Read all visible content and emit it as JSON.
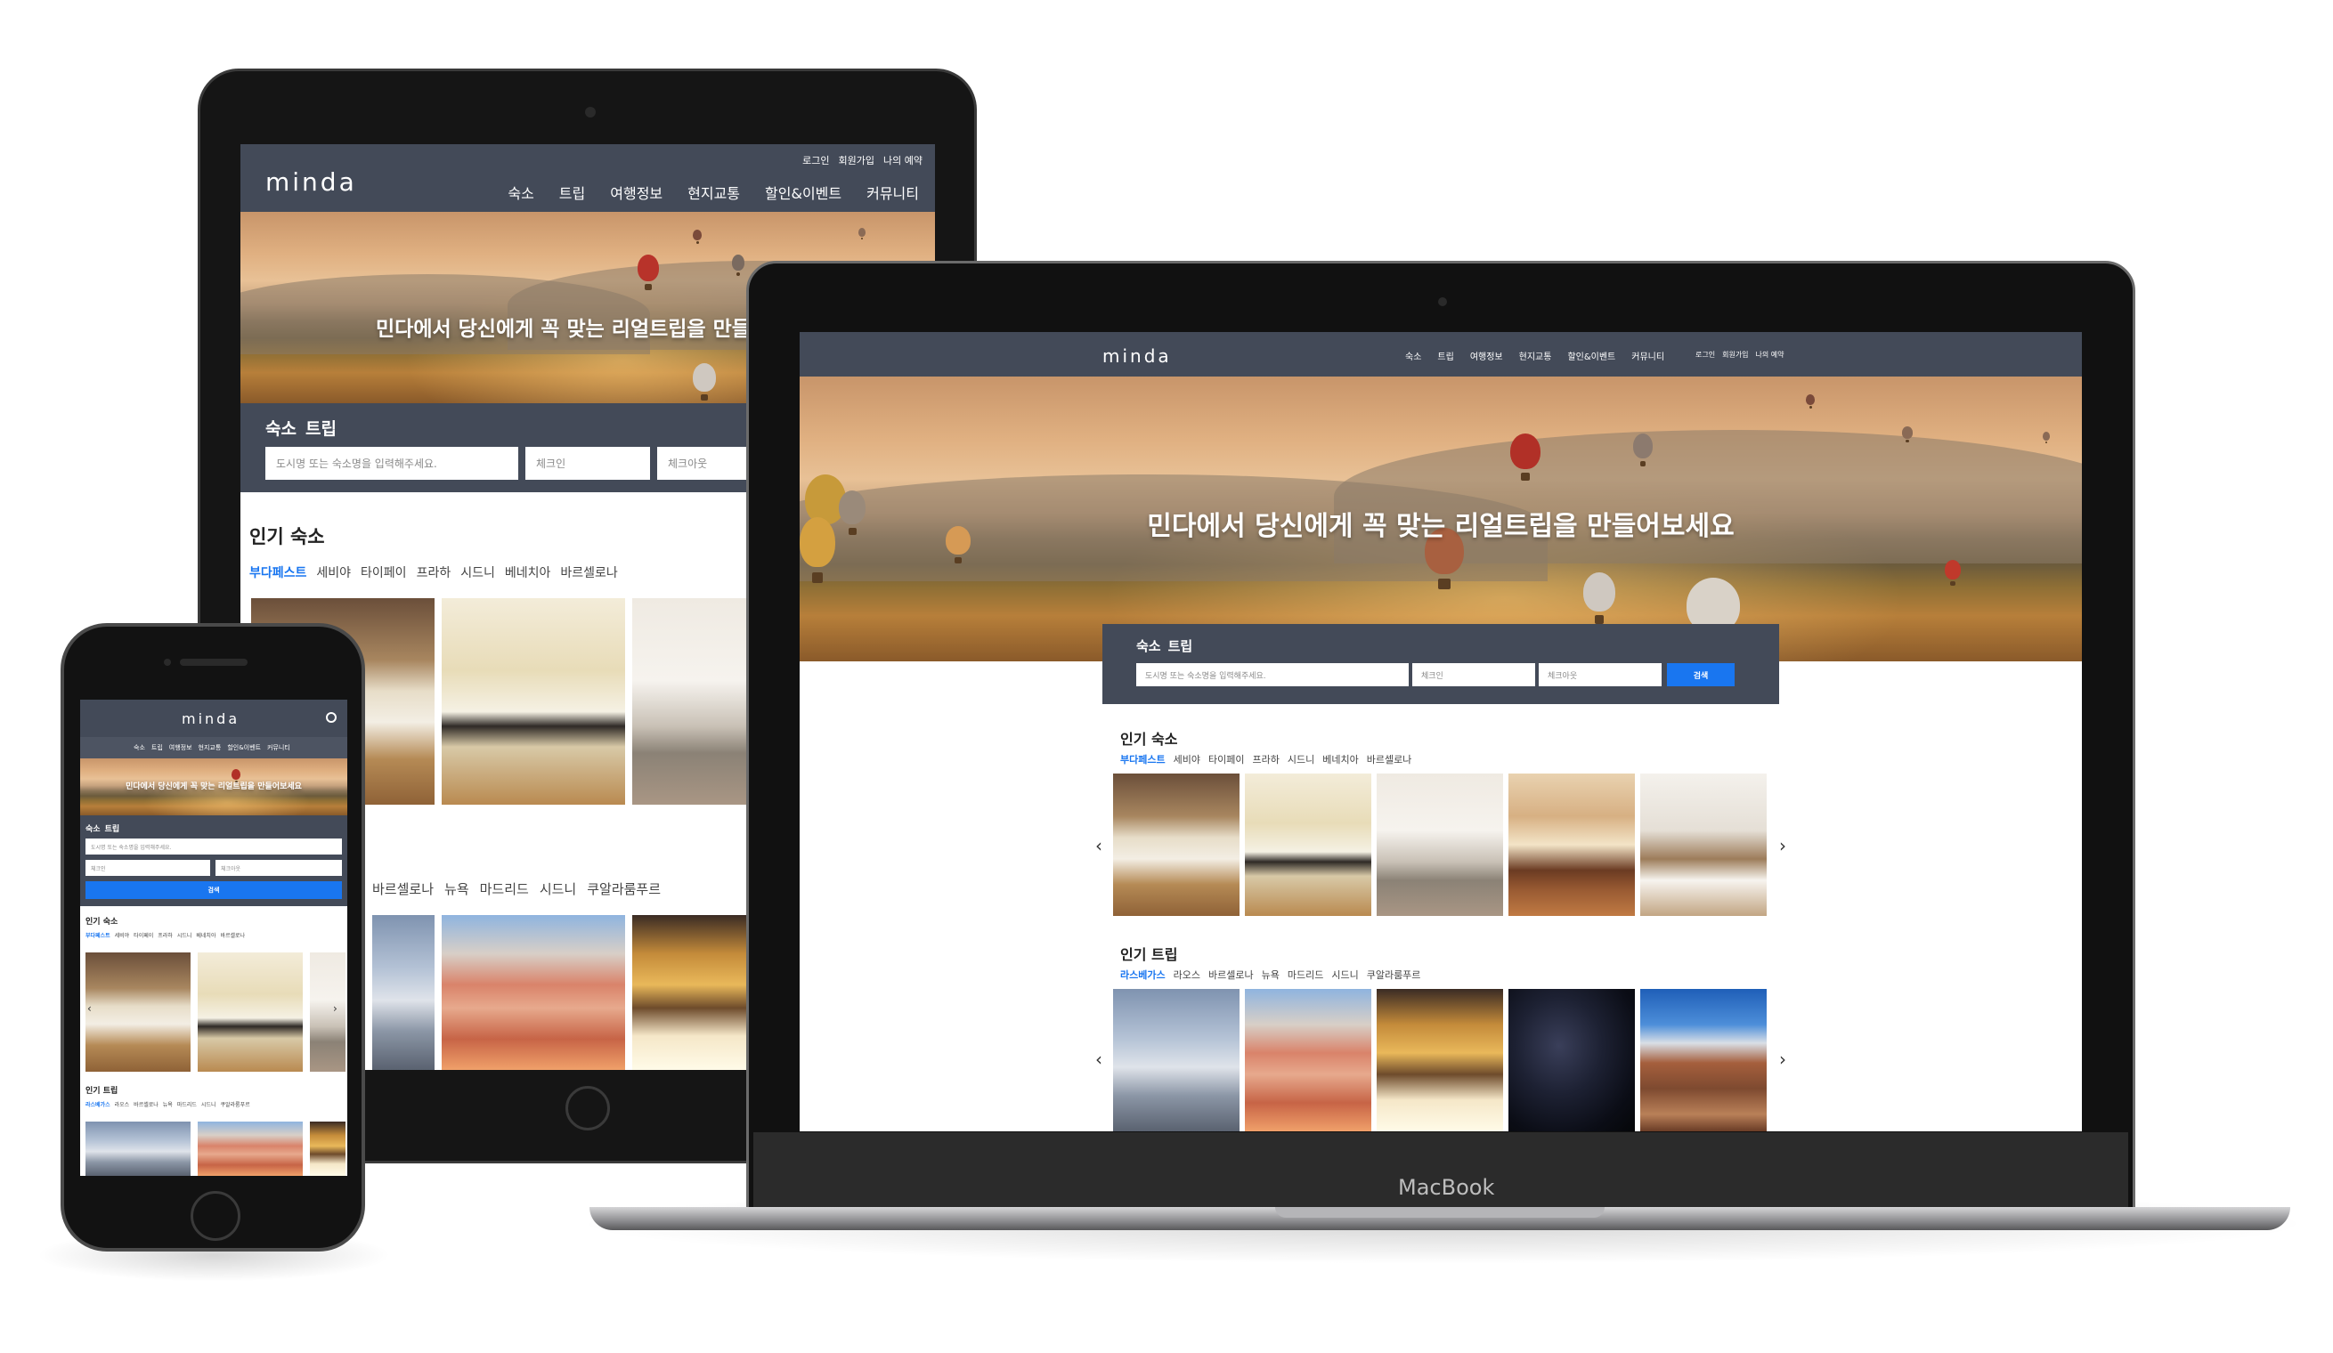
{
  "brand": {
    "logo": "minda"
  },
  "nav": {
    "util": [
      "로그인",
      "회원가입",
      "나의 예약"
    ],
    "menu": [
      "숙소",
      "트립",
      "여행정보",
      "현지교통",
      "할인&이벤트",
      "커뮤니티"
    ]
  },
  "hero": {
    "headline": "민다에서 당신에게 꼭 맞는 리얼트립을 만들어보세요",
    "headline_tablet": "민다에서 당신에게 꼭 맞는 리얼트립을 만들어"
  },
  "search": {
    "tab_stay": "숙소",
    "tab_trip": "트립",
    "destination_placeholder": "도시명 또는 숙소명을 입력해주세요.",
    "checkin": "체크인",
    "checkout": "체크아웃",
    "button": "검색"
  },
  "popular_stays": {
    "title": "인기 숙소",
    "cities": [
      "부다페스트",
      "세비야",
      "타이페이",
      "프라하",
      "시드니",
      "베네치아",
      "바르셀로나"
    ]
  },
  "popular_trips": {
    "title": "인기 트립",
    "cities": [
      "라스베가스",
      "라오스",
      "바르셀로나",
      "뉴욕",
      "마드리드",
      "시드니",
      "쿠알라룸푸르"
    ],
    "cities_tablet": [
      "바르셀로나",
      "뉴욕",
      "마드리드",
      "시드니",
      "쿠알라룸푸르"
    ]
  },
  "laptop": {
    "brand_label": "MacBook"
  },
  "icons": {
    "prev": "chevron-left-icon",
    "next": "chevron-right-icon",
    "user": "user-circle-icon",
    "home": "home-button-icon"
  },
  "colors": {
    "header": "#434a58",
    "accent": "#1976f0",
    "device": "#161616"
  }
}
